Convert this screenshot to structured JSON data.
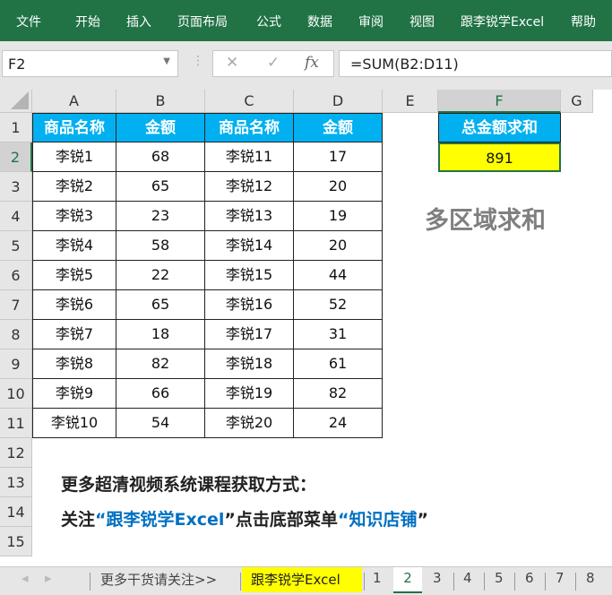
{
  "ribbon": {
    "tabs": [
      "文件",
      "开始",
      "插入",
      "页面布局",
      "公式",
      "数据",
      "审阅",
      "视图",
      "跟李锐学Excel",
      "帮助"
    ]
  },
  "formula_bar": {
    "name_box": "F2",
    "cancel": "✕",
    "enter": "✓",
    "fx": "fx",
    "formula": "=SUM(B2:D11)"
  },
  "columns": [
    "A",
    "B",
    "C",
    "D",
    "E",
    "F",
    "G"
  ],
  "rows": [
    "1",
    "2",
    "3",
    "4",
    "5",
    "6",
    "7",
    "8",
    "9",
    "10",
    "11",
    "12",
    "13",
    "14",
    "15"
  ],
  "table": {
    "headers": [
      "商品名称",
      "金额",
      "商品名称",
      "金额"
    ],
    "data": [
      [
        "李锐1",
        "68",
        "李锐11",
        "17"
      ],
      [
        "李锐2",
        "65",
        "李锐12",
        "20"
      ],
      [
        "李锐3",
        "23",
        "李锐13",
        "19"
      ],
      [
        "李锐4",
        "58",
        "李锐14",
        "20"
      ],
      [
        "李锐5",
        "22",
        "李锐15",
        "44"
      ],
      [
        "李锐6",
        "65",
        "李锐16",
        "52"
      ],
      [
        "李锐7",
        "18",
        "李锐17",
        "31"
      ],
      [
        "李锐8",
        "82",
        "李锐18",
        "61"
      ],
      [
        "李锐9",
        "66",
        "李锐19",
        "82"
      ],
      [
        "李锐10",
        "54",
        "李锐20",
        "24"
      ]
    ]
  },
  "summary": {
    "header": "总金额求和",
    "value": "891"
  },
  "title": "多区域求和",
  "promo": {
    "line1": "更多超清视频系统课程获取方式：",
    "line2_a": "关注",
    "q1": "“",
    "brand": "跟李锐学Excel",
    "q2": "”",
    "line2_b": "点击底部菜单",
    "q3": "“",
    "shop": "知识店铺",
    "q4": "”"
  },
  "sheet_tabs": [
    "更多干货请关注>>",
    "跟李锐学Excel",
    "1",
    "2",
    "3",
    "4",
    "5",
    "6",
    "7",
    "8"
  ],
  "colors": {
    "ribbon": "#217346",
    "header_fill": "#00b0f0",
    "highlight": "#ffff00",
    "link_blue": "#0070c0"
  }
}
